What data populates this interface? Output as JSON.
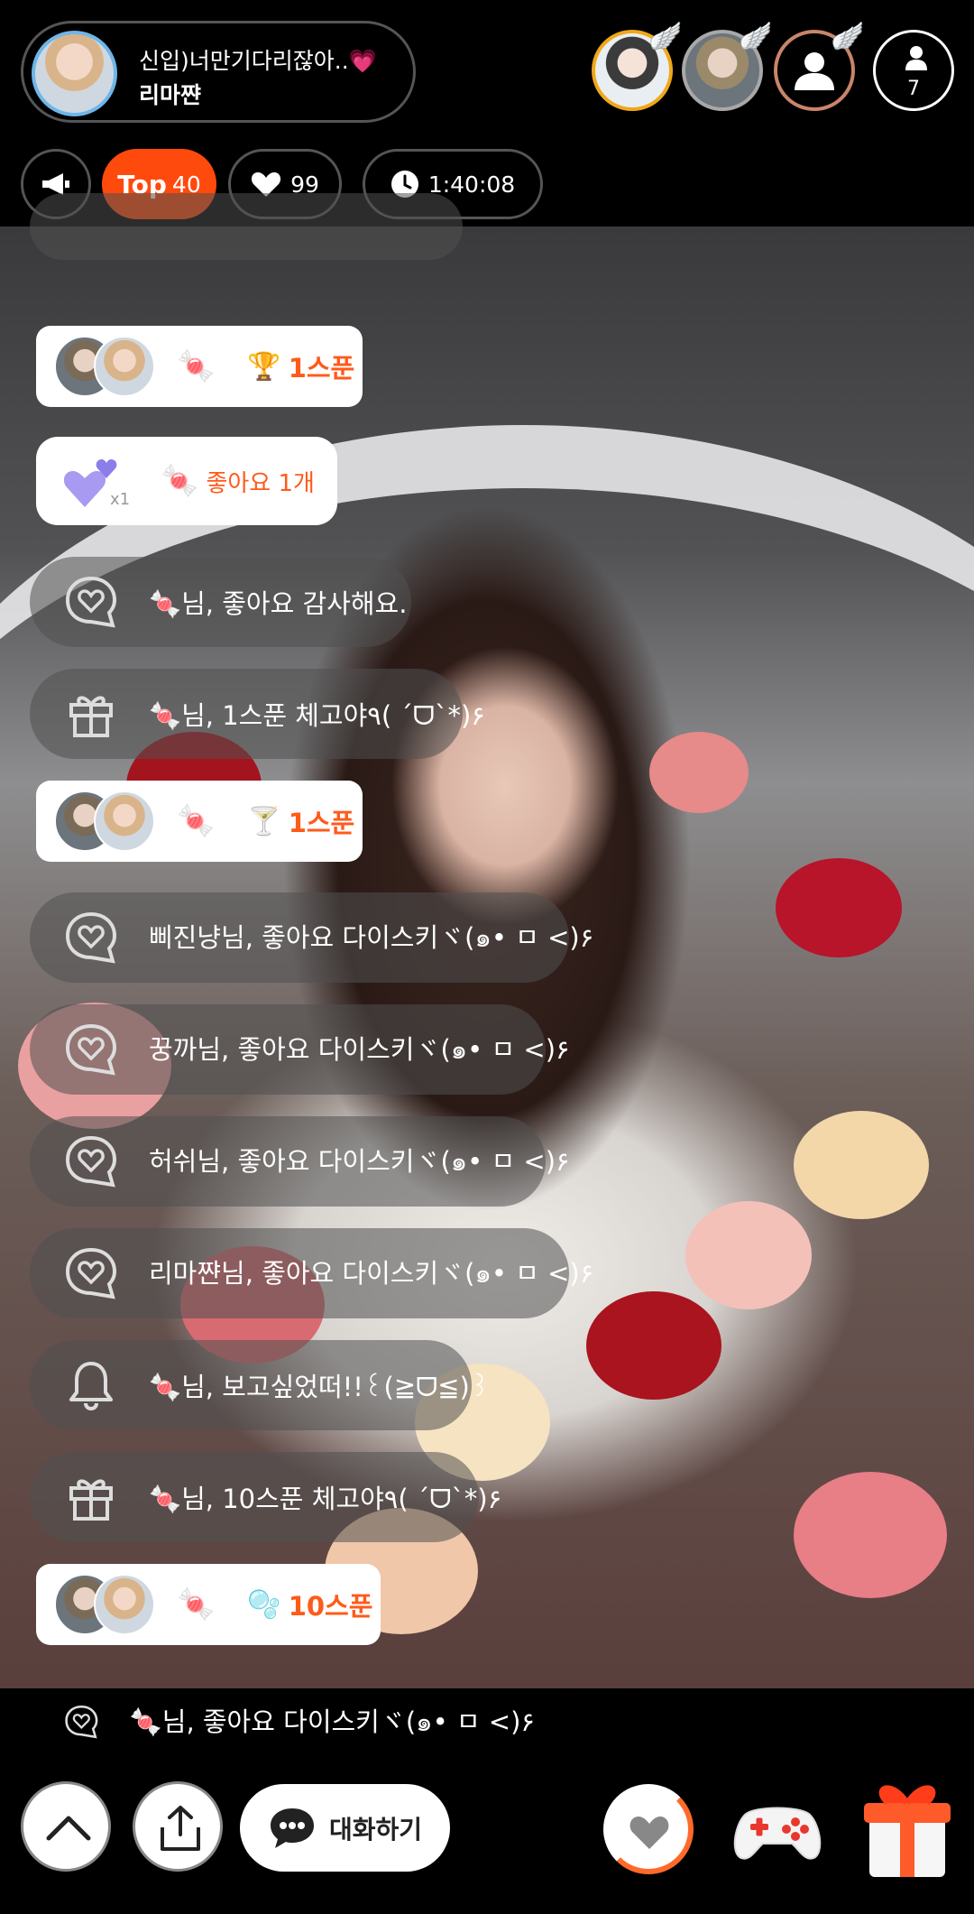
{
  "host": {
    "title": "신입)너만기다리잖아..",
    "title_heart": "💗",
    "name": "리마쨘"
  },
  "viewers": {
    "count": "7"
  },
  "chips": {
    "top_label": "Top",
    "top_value": "40",
    "likes": "99",
    "time": "1:40:08"
  },
  "messages": [
    {
      "type": "like_event",
      "text": "좋아요 1개",
      "count": "x1"
    },
    {
      "type": "system",
      "icon": "heart-chat-icon",
      "text": "🍬님, 좋아요 감사해요."
    },
    {
      "type": "system",
      "icon": "gift-icon",
      "text": "🍬님, 1스푼 체고야٩( ´ᗜ`*)۶"
    },
    {
      "type": "system",
      "icon": "heart-chat-icon",
      "text": "삐진냥님, 좋아요 다이스키ヾ(๑• ㅁ <)۶"
    },
    {
      "type": "system",
      "icon": "heart-chat-icon",
      "text": "꿍까님, 좋아요 다이스키ヾ(๑• ㅁ <)۶"
    },
    {
      "type": "system",
      "icon": "heart-chat-icon",
      "text": "허쉬님, 좋아요 다이스키ヾ(๑• ㅁ <)۶"
    },
    {
      "type": "system",
      "icon": "heart-chat-icon",
      "text": "리마쨘님, 좋아요 다이스키ヾ(๑• ㅁ <)۶"
    },
    {
      "type": "system",
      "icon": "bell-icon",
      "text": "🍬님, 보고싶었떠!!꒰(≧ᗜ≦)꒱"
    },
    {
      "type": "system",
      "icon": "gift-icon",
      "text": "🍬님, 10스푼 체고야٩( ´ᗜ`*)۶"
    },
    {
      "type": "system",
      "icon": "heart-chat-icon",
      "text": "🍬님, 좋아요 다이스키ヾ(๑• ㅁ <)۶"
    }
  ],
  "gifts": [
    {
      "sender": "🍬",
      "amount": "1스푼"
    },
    {
      "sender": "🍬",
      "amount": "1스푼"
    },
    {
      "sender": "🍬",
      "amount": "10스푼"
    }
  ],
  "bottom": {
    "chat_label": "대화하기"
  },
  "colors": {
    "accent": "#ff4a0d",
    "bubble": "rgba(80,80,80,0.55)"
  }
}
